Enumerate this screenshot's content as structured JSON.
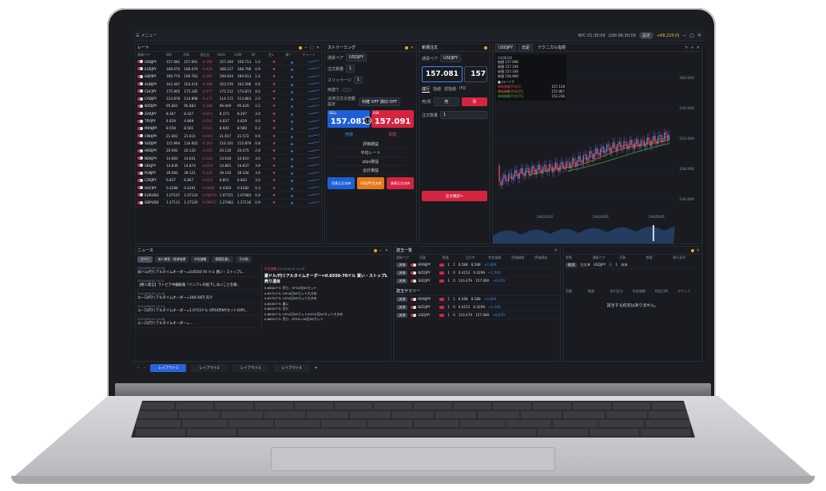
{
  "topbar": {
    "menu_label": "メニュー",
    "clock1": "NYC 01:30:09",
    "clock2": "LON 06:30:09",
    "amount": "+68,220 円",
    "pill": "設定"
  },
  "rates_panel": {
    "title": "レート",
    "columns": [
      "通貨ペア",
      "BID",
      "ASK",
      "前日比",
      "HIGH",
      "LOW",
      "SP",
      "売↓",
      "買↑",
      "チャート"
    ],
    "rows": [
      {
        "pair": "USDJPY",
        "bid": "157.081",
        "ask": "157.091",
        "chg": "-0.195",
        "high": "157.194",
        "low": "156.713",
        "sp": "1.0"
      },
      {
        "pair": "EURJPY",
        "bid": "168.070",
        "ask": "168.079",
        "chg": "-0.429",
        "high": "168.217",
        "low": "168.798",
        "sp": "0.9"
      },
      {
        "pair": "GBPJPY",
        "bid": "199.774",
        "ask": "199.783",
        "chg": "-0.182",
        "high": "199.924",
        "low": "199.613",
        "sp": "1.0"
      },
      {
        "pair": "AUDJPY",
        "bid": "103.497",
        "ask": "103.474",
        "chg": "-0.186",
        "high": "103.576",
        "low": "103.596",
        "sp": "0.6"
      },
      {
        "pair": "CHFJPY",
        "bid": "175.965",
        "ask": "175.185",
        "chg": "-0.277",
        "high": "175.112",
        "low": "174.873",
        "sp": "4.0"
      },
      {
        "pair": "CADJPY",
        "bid": "114.878",
        "ask": "114.898",
        "chg": "-0.172",
        "high": "114.172",
        "low": "113.863",
        "sp": "2.0"
      },
      {
        "pair": "NZDJPY",
        "bid": "95.861",
        "ask": "95.883",
        "chg": "-0.180",
        "high": "96.069",
        "low": "95.629",
        "sp": "2.2"
      },
      {
        "pair": "ZARJPY",
        "bid": "8.367",
        "ask": "8.337",
        "chg": "-0.014",
        "high": "8.373",
        "low": "8.297",
        "sp": "3.0"
      },
      {
        "pair": "TRYJPY",
        "bid": "4.829",
        "ask": "4.869",
        "chg": "-0.012",
        "high": "4.837",
        "low": "4.829",
        "sp": "4.0"
      },
      {
        "pair": "MXNJPY",
        "bid": "8.558",
        "ask": "8.561",
        "chg": "-0.021",
        "high": "8.600",
        "low": "8.560",
        "sp": "0.3"
      },
      {
        "pair": "CNHJPY",
        "bid": "21.602",
        "ask": "21.611",
        "chg": "-0.024",
        "high": "21.617",
        "low": "21.572",
        "sp": "0.9"
      },
      {
        "pair": "SGDJPY",
        "bid": "115.994",
        "ask": "116.002",
        "chg": "-0.164",
        "high": "116.101",
        "low": "115.879",
        "sp": "0.8"
      },
      {
        "pair": "HKDJPY",
        "bid": "20.092",
        "ask": "20.120",
        "chg": "-0.025",
        "high": "20.130",
        "low": "20.075",
        "sp": "2.8"
      },
      {
        "pair": "NOKJPY",
        "bid": "14.683",
        "ask": "14.641",
        "chg": "-0.034",
        "high": "14.634",
        "low": "14.610",
        "sp": "3.0"
      },
      {
        "pair": "SEKJPY",
        "bid": "14.836",
        "ask": "14.874",
        "chg": "-0.019",
        "high": "14.861",
        "low": "14.837",
        "sp": "3.8"
      },
      {
        "pair": "PLNJPY",
        "bid": "39.082",
        "ask": "39.121",
        "chg": "-0.120",
        "high": "39.193",
        "low": "39.104",
        "sp": "3.9"
      },
      {
        "pair": "CZKJPY",
        "bid": "6.837",
        "ask": "6.867",
        "chg": "-0.013",
        "high": "6.851",
        "low": "6.843",
        "sp": "3.0"
      },
      {
        "pair": "HUFJPY",
        "bid": "0.4288",
        "ask": "0.4291",
        "chg": "-0.0004",
        "high": "0.4303",
        "low": "0.4282",
        "sp": "0.3"
      },
      {
        "pair": "EURUSD",
        "bid": "1.07107",
        "ask": "1.07124",
        "chg": "-0.00074",
        "high": "1.07151",
        "low": "1.07083",
        "sp": "0.4"
      },
      {
        "pair": "GBPUSD",
        "bid": "1.27111",
        "ask": "1.27120",
        "chg": "-0.00072",
        "high": "1.27082",
        "low": "1.27116",
        "sp": "0.9"
      }
    ]
  },
  "streaming": {
    "title": "ストリーミング",
    "pair_label": "通貨ペア",
    "pair": "USDJPY",
    "qty_label": "注文数量",
    "qty": "1",
    "slippage_label": "スリッページ",
    "slippage": "1",
    "hedge_label": "両建て",
    "settle_label": "決済注文の自動設定",
    "settle_value": "利確 OFF 損切 OFF",
    "sell_label": "SELL",
    "buy_label": "ASK",
    "sell_price": "157.081",
    "buy_price": "157.091",
    "spread": "1.0",
    "sell_side": "売建",
    "buy_side": "買建",
    "stats": [
      "評価損益",
      "平均レート",
      "pips損益",
      "合計損益"
    ],
    "btn_left": "売建玉全決済",
    "btn_mid": "USDJPY全決済",
    "btn_right": "買建玉全決済"
  },
  "new_order": {
    "title": "新規注文",
    "pair_label": "通貨ペア",
    "pair": "USDJPY",
    "bid_price": "157.081",
    "ask_price_partial": "157",
    "spread": "1.0",
    "tabs": [
      "成行",
      "指値",
      "逆指値",
      "IFD"
    ],
    "side_label": "売/買",
    "sell": "売",
    "buy": "買",
    "qty_label": "注文数量",
    "qty": "1",
    "confirm": "注文確認へ"
  },
  "chart_panel": {
    "pair": "USDJPY",
    "timeframe": "日足",
    "indicator_label": "テクニカル指標",
    "ohlc_date": "24/06/28",
    "ohlc": [
      "始値 157.068",
      "高値 157.194",
      "安値 157.108",
      "終値 156.969"
    ],
    "rate_label": "ローソク",
    "ma_labels": [
      "単純移動平均(5)",
      "単純移動平均(25)",
      "単純移動平均(75)"
    ],
    "ma_values": [
      "157.139",
      "155.867",
      "152.236"
    ],
    "y_ticks": [
      "160.000",
      "156.000",
      "152.000",
      "148.000",
      "144.000"
    ],
    "x_ticks": [
      "24/01/02",
      "24/03/01",
      "24/05/01"
    ]
  },
  "news": {
    "title": "ニュース",
    "tabs": [
      "すべて",
      "新人教室・経済指標",
      "市況速報",
      "相場見通し",
      "その他"
    ],
    "items": [
      {
        "time": "2024/06/18 14:28",
        "headline": "米ドル/円リアルタイムオーダー=0.6550-70 ドル 買い・ストップL..."
      },
      {
        "time": "2024/06/18 14:21",
        "headline": "【要人発言】ラトビア中銀総裁「インフレの低下しないことを確..."
      },
      {
        "time": "2024/06/18 14:18",
        "headline": "ユーロ/円リアルタイムオーダー=169.50円 売り"
      },
      {
        "time": "2024/06/18 14:14",
        "headline": "ユーロ/円リアルタイムオーダー=1.0715ドル OP10月NYカット(OP1..."
      },
      {
        "time": "2024/06/18 14:08",
        "headline": "ユーロ/円リアルタイムオーダー=..."
      }
    ],
    "detail_tag": "市況速報",
    "detail_time": "2024/06/18 14:28",
    "detail_title": "豪ドル/円リアルタイムオーダー=0.6550-70ドル 買い・ストップL売り湯目",
    "detail_lines": [
      "0.6600ドル 売り、OP10日NYカット",
      "0.6575ドル OP10日NYカット大きめ",
      "0.6570ドル OP10日NYカット大きめ",
      "0.6550ドル 買い",
      "0.6650ドル 売り",
      "0.6630ドル OP10日NYカット/OP10日NYカット大きめ",
      "0.6620ドル 売り、OP10=16日NYカット"
    ]
  },
  "positions": {
    "title": "建玉一覧",
    "columns": [
      "通貨ペア",
      "売買",
      "数量",
      "注文中",
      "約定価格",
      "評価価格",
      "評価損益"
    ],
    "rows": [
      {
        "tag": "決済",
        "pair": "MXNJPY",
        "qty": "1",
        "pending": "1",
        "price": "8.588",
        "eval": "8.588",
        "pl": "+2,800"
      },
      {
        "tag": "決済",
        "pair": "NZDJPY",
        "qty": "1",
        "pending": "0",
        "price": "0.4152",
        "eval": "0.4299",
        "pl": "+1,500"
      },
      {
        "tag": "決済",
        "pair": "SGDJPY",
        "qty": "1",
        "pending": "0",
        "price": "116.479",
        "eval": "157.080",
        "pl": "+6,670"
      }
    ],
    "summary_title": "建玉サマリー",
    "summary_rows": [
      {
        "tag": "決済",
        "pair": "MXNJPY",
        "qty": "1",
        "pending": "1",
        "price": "8.588",
        "eval": "8.588",
        "pl": "+2,800"
      },
      {
        "tag": "決済",
        "pair": "NZDJPY",
        "qty": "1",
        "pending": "0",
        "price": "0.4152",
        "eval": "0.4299",
        "pl": "+1,500"
      },
      {
        "tag": "決済",
        "pair": "USDJPY",
        "qty": "1",
        "pending": "0",
        "price": "116.479",
        "eval": "157.080",
        "pl": "+6,670"
      }
    ]
  },
  "orders": {
    "columns": [
      "状態",
      "通貨ペア",
      "売買",
      "数量",
      "執行条件"
    ],
    "row": {
      "tag": "取消",
      "status": "注文済",
      "pair": "USDJPY",
      "side": "売",
      "qty": "1",
      "cond": "決済"
    },
    "exec_columns": [
      "売買",
      "数量",
      "取引区分",
      "約定価格",
      "約定日時",
      "スワップ"
    ],
    "empty": "該当する約定はありません。"
  },
  "layout_tabs": [
    "レイアウト1",
    "レイアウト2",
    "レイアウト3",
    "レイアウト4"
  ]
}
